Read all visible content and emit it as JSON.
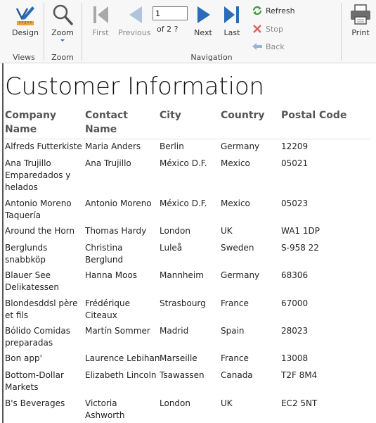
{
  "toolbar": {
    "views": {
      "group_label": "Views",
      "design_label": "Design"
    },
    "zoom": {
      "group_label": "Zoom",
      "zoom_label": "Zoom"
    },
    "navigation": {
      "group_label": "Navigation",
      "first_label": "First",
      "previous_label": "Previous",
      "page_value": "1",
      "of_text": "of  2 ?",
      "next_label": "Next",
      "last_label": "Last",
      "refresh_label": "Refresh",
      "stop_label": "Stop",
      "back_label": "Back"
    },
    "print": {
      "print_label": "Print"
    }
  },
  "report": {
    "title": "Customer Information",
    "headers": [
      "Company Name",
      "Contact Name",
      "City",
      "Country",
      "Postal Code"
    ],
    "rows": [
      {
        "company": "Alfreds Futterkiste",
        "contact": "Maria Anders",
        "city": "Berlin",
        "country": "Germany",
        "postal": "12209"
      },
      {
        "company": "Ana Trujillo Emparedados y helados",
        "contact": "Ana Trujillo",
        "city": "México D.F.",
        "country": "Mexico",
        "postal": "05021"
      },
      {
        "company": "Antonio Moreno Taquería",
        "contact": "Antonio Moreno",
        "city": "México D.F.",
        "country": "Mexico",
        "postal": "05023"
      },
      {
        "company": "Around the Horn",
        "contact": "Thomas Hardy",
        "city": "London",
        "country": "UK",
        "postal": "WA1 1DP"
      },
      {
        "company": "Berglunds snabbköp",
        "contact": "Christina Berglund",
        "city": "Luleå",
        "country": "Sweden",
        "postal": "S-958 22"
      },
      {
        "company": "Blauer See Delikatessen",
        "contact": "Hanna Moos",
        "city": "Mannheim",
        "country": "Germany",
        "postal": "68306"
      },
      {
        "company": "Blondesddsl père et fils",
        "contact": "Frédérique Citeaux",
        "city": "Strasbourg",
        "country": "France",
        "postal": "67000"
      },
      {
        "company": "Bólido Comidas preparadas",
        "contact": "Martín Sommer",
        "city": "Madrid",
        "country": "Spain",
        "postal": "28023"
      },
      {
        "company": "Bon app'",
        "contact": "Laurence Lebihan",
        "city": "Marseille",
        "country": "France",
        "postal": "13008"
      },
      {
        "company": "Bottom-Dollar Markets",
        "contact": "Elizabeth Lincoln",
        "city": "Tsawassen",
        "country": "Canada",
        "postal": "T2F 8M4"
      },
      {
        "company": "B's Beverages",
        "contact": "Victoria Ashworth",
        "city": "London",
        "country": "UK",
        "postal": "EC2 5NT"
      }
    ]
  }
}
